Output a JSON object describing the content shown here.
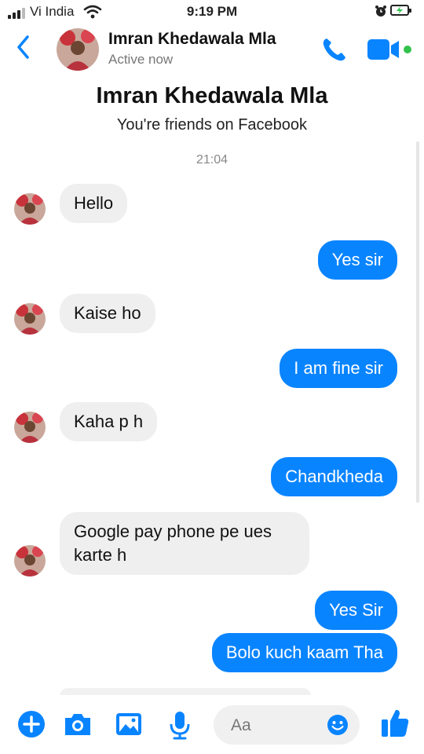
{
  "status_bar": {
    "carrier": "Vi India",
    "time": "9:19 PM"
  },
  "header": {
    "name": "Imran Khedawala Mla",
    "status": "Active now"
  },
  "profile": {
    "name": "Imran Khedawala Mla",
    "note": "You're friends on Facebook"
  },
  "timestamp": "21:04",
  "messages": [
    {
      "sender": "them",
      "text": "Hello"
    },
    {
      "sender": "me",
      "text": "Yes sir"
    },
    {
      "sender": "them",
      "text": "Kaise ho"
    },
    {
      "sender": "me",
      "text": "I am fine sir"
    },
    {
      "sender": "them",
      "text": "Kaha p h"
    },
    {
      "sender": "me",
      "text": "Chandkheda"
    },
    {
      "sender": "them",
      "text": "Google pay phone pe ues karte h"
    },
    {
      "sender": "me",
      "text": "Yes Sir"
    },
    {
      "sender": "me",
      "text": "Bolo kuch kaam Tha"
    }
  ],
  "composer": {
    "placeholder": "Aa"
  },
  "icons": {
    "back": "chevron-left-icon",
    "call": "phone-icon",
    "video": "video-camera-icon",
    "more": "plus-circle-icon",
    "camera": "camera-icon",
    "gallery": "image-icon",
    "voice": "microphone-icon",
    "emoji": "emoji-icon",
    "like": "thumbs-up-icon"
  },
  "colors": {
    "accent": "#0984ff",
    "incoming_bubble": "#efefef",
    "online": "#32c24d"
  }
}
